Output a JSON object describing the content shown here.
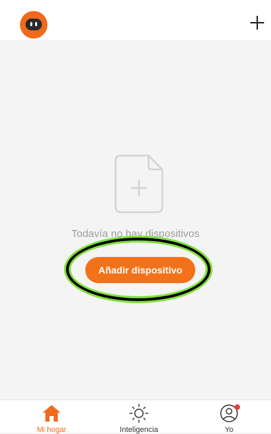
{
  "header": {
    "avatar_icon": "robot-avatar-icon",
    "add_icon": "plus-icon"
  },
  "main": {
    "empty_icon": "file-add-icon",
    "empty_text": "Todavía no hay dispositivos",
    "add_button_label": "Añadir dispositivo"
  },
  "tabbar": {
    "tabs": [
      {
        "label": "Mi hogar",
        "icon": "home-icon",
        "active": true
      },
      {
        "label": "Inteligencia",
        "icon": "sun-icon",
        "active": false
      },
      {
        "label": "Yo",
        "icon": "user-icon",
        "active": false,
        "badge": true
      }
    ]
  },
  "colors": {
    "accent": "#f37219",
    "background": "#f4f4f4",
    "highlight_ring": "#7fe03a"
  }
}
